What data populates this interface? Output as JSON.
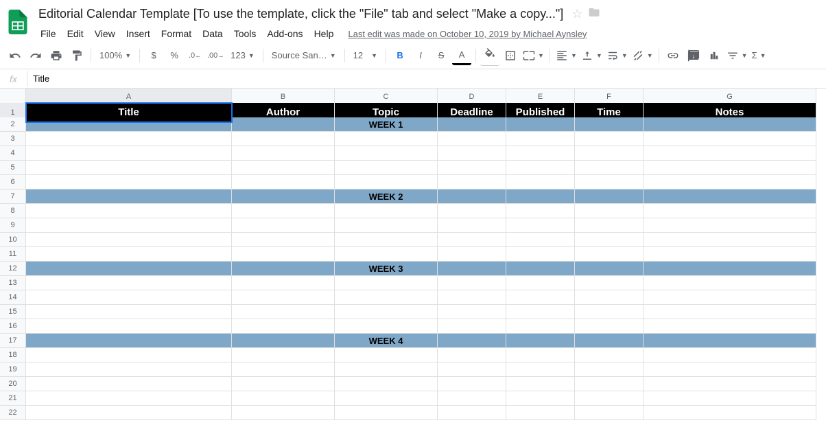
{
  "doc_title": "Editorial Calendar Template  [To use the template, click the \"File\" tab and select \"Make a copy...\"]",
  "menu": {
    "file": "File",
    "edit": "Edit",
    "view": "View",
    "insert": "Insert",
    "format": "Format",
    "data": "Data",
    "tools": "Tools",
    "addons": "Add-ons",
    "help": "Help"
  },
  "last_edit": "Last edit was made on October 10, 2019 by Michael Aynsley",
  "toolbar": {
    "zoom": "100%",
    "font": "Source San…",
    "size": "12"
  },
  "formula": {
    "label": "fx",
    "value": "Title"
  },
  "columns": [
    "A",
    "B",
    "C",
    "D",
    "E",
    "F",
    "G"
  ],
  "rows": [
    "1",
    "2",
    "3",
    "4",
    "5",
    "6",
    "7",
    "8",
    "9",
    "10",
    "11",
    "12",
    "13",
    "14",
    "15",
    "16",
    "17",
    "18",
    "19",
    "20",
    "21",
    "22"
  ],
  "headers": [
    "Title",
    "Author",
    "Topic",
    "Deadline",
    "Published",
    "Time",
    "Notes"
  ],
  "weeks": {
    "r2": "WEEK 1",
    "r7": "WEEK 2",
    "r12": "WEEK 3",
    "r17": "WEEK 4"
  },
  "selected_cell": "A1"
}
